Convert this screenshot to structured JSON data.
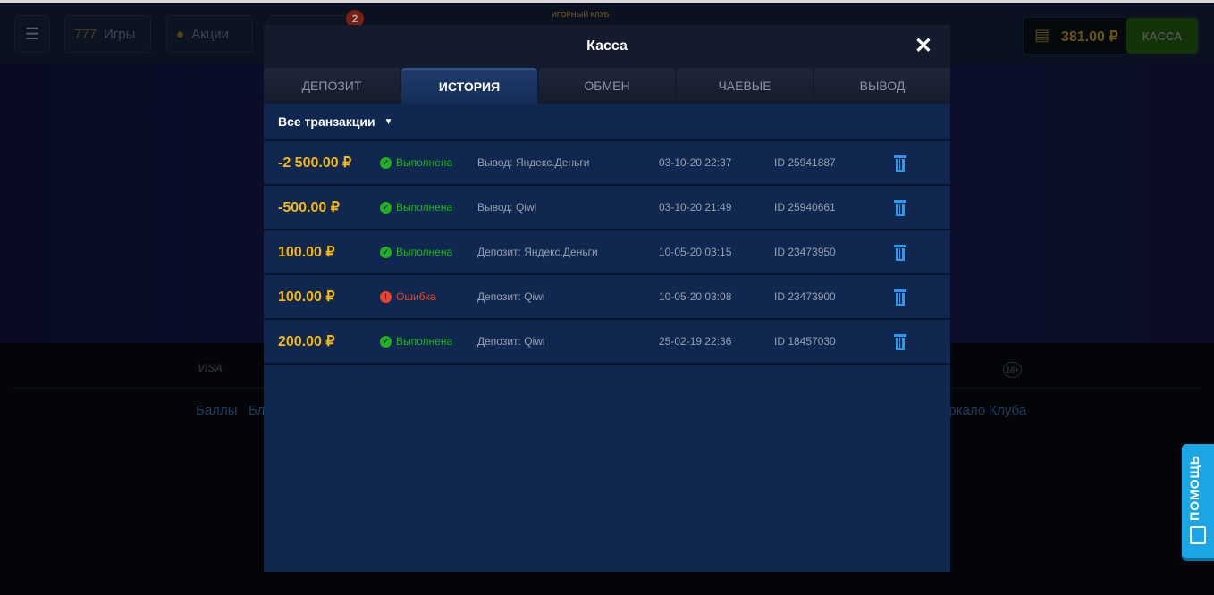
{
  "header": {
    "games": "Игры",
    "promos": "Акции",
    "notifications_count": "2",
    "logo_text": "ИГОРНЫЙ КЛУБ",
    "balance": "381.00 ₽",
    "kassa_button": "КАССА"
  },
  "footer": {
    "payments": "VISA",
    "age": "18+",
    "links": [
      "Баллы",
      "Блог",
      "Зеркало Клуба"
    ]
  },
  "help": {
    "label": "ПОМОЩЬ"
  },
  "modal": {
    "title": "Касса",
    "tabs": [
      {
        "label": "ДЕПОЗИТ"
      },
      {
        "label": "ИСТОРИЯ",
        "active": true
      },
      {
        "label": "ОБМЕН"
      },
      {
        "label": "ЧАЕВЫЕ"
      },
      {
        "label": "ВЫВОД"
      }
    ],
    "filter": "Все транзакции",
    "transactions": [
      {
        "amount": "-2 500.00 ₽",
        "status": "Выполнена",
        "ok": true,
        "desc": "Вывод: Яндекс.Деньги",
        "date": "03-10-20 22:37",
        "id": "ID 25941887"
      },
      {
        "amount": "-500.00 ₽",
        "status": "Выполнена",
        "ok": true,
        "desc": "Вывод: Qiwi",
        "date": "03-10-20 21:49",
        "id": "ID 25940661"
      },
      {
        "amount": "100.00 ₽",
        "status": "Выполнена",
        "ok": true,
        "desc": "Депозит: Яндекс.Деньги",
        "date": "10-05-20 03:15",
        "id": "ID 23473950"
      },
      {
        "amount": "100.00 ₽",
        "status": "Ошибка",
        "ok": false,
        "desc": "Депозит: Qiwi",
        "date": "10-05-20 03:08",
        "id": "ID 23473900"
      },
      {
        "amount": "200.00 ₽",
        "status": "Выполнена",
        "ok": true,
        "desc": "Депозит: Qiwi",
        "date": "25-02-19 22:36",
        "id": "ID 18457030"
      }
    ]
  },
  "colors": {
    "success": "#22b11e",
    "error": "#e8462c",
    "amount": "#f6b80d",
    "accent": "#2a9af0"
  }
}
